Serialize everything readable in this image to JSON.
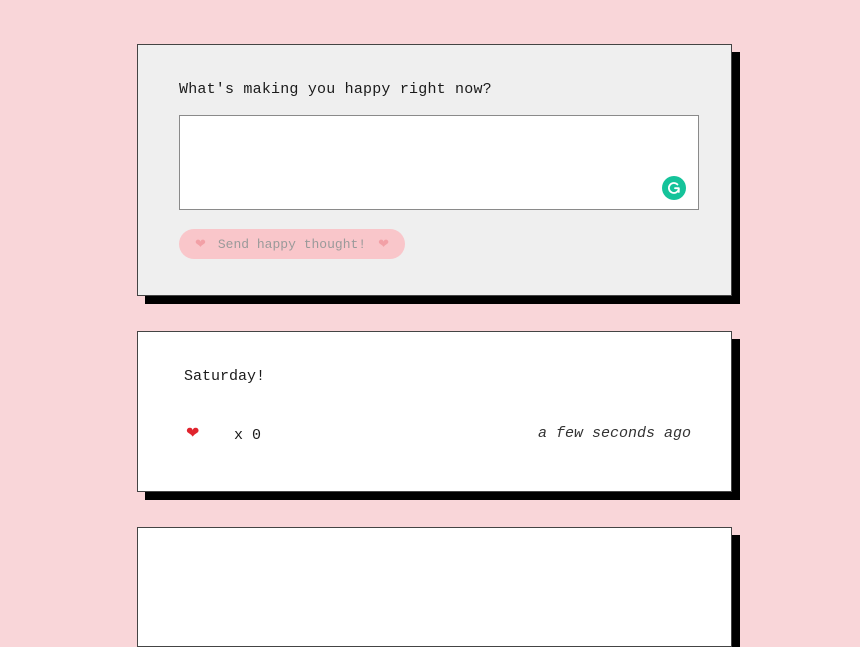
{
  "compose": {
    "prompt": "What's making you happy right now?",
    "textarea_value": "",
    "send_label": "Send happy thought!",
    "heart_glyph": "❤"
  },
  "thoughts": [
    {
      "message": "Saturday!",
      "heart_glyph": "❤",
      "likes": "x 0",
      "time": "a few seconds ago"
    }
  ],
  "colors": {
    "background": "#f9d6d9",
    "card_shadow": "#000000",
    "button_bg": "#f9c6ca",
    "heart": "#e0242e",
    "grammarly": "#15c39a"
  },
  "icons": {
    "grammarly": "grammarly-icon",
    "heart": "heart-icon"
  }
}
